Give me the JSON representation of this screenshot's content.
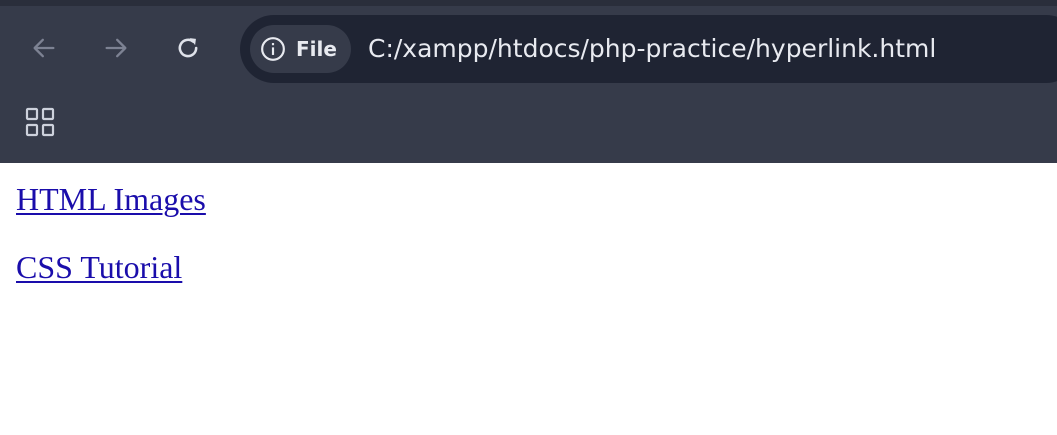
{
  "browser": {
    "address_bar": {
      "site_chip_label": "File",
      "site_chip_icon": "info-icon",
      "url": "C:/xampp/htdocs/php-practice/hyperlink.html"
    },
    "icons": {
      "back": "back-arrow-icon",
      "forward": "forward-arrow-icon",
      "reload": "reload-icon",
      "apps": "apps-grid-icon"
    },
    "colors": {
      "chrome_background": "#363b4a",
      "omnibox_background": "#1f2433",
      "link": "#1a0dab"
    }
  },
  "page": {
    "links": [
      {
        "label": "HTML Images"
      },
      {
        "label": "CSS Tutorial"
      }
    ]
  }
}
